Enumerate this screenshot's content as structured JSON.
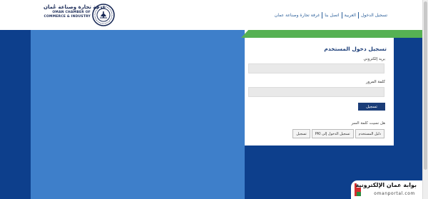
{
  "header": {
    "brand_ar": "غرفة تجارة وصناعة عُمان",
    "brand_en_line1": "OMAN CHAMBER OF",
    "brand_en_line2": "COMMERCE & INDUSTRY",
    "nav": [
      {
        "label": "تسجيل الدخول"
      },
      {
        "label": "العربية"
      },
      {
        "label": "اتصل بنا"
      },
      {
        "label": "غرفة تجارة وصناعة عمان"
      }
    ]
  },
  "login": {
    "title": "تسجيل دخول المستخدم",
    "email_label": "بريد إلكتروني",
    "email_value": "",
    "password_label": "كلمة المرور",
    "password_value": "",
    "login_button": "تسجيل",
    "forgot_text": "هل نسيت كلمة السر",
    "buttons": [
      {
        "label": "دليل المستخدم"
      },
      {
        "label": "PKI تسجيل الدخول إلى"
      },
      {
        "label": "تسجيل"
      }
    ]
  },
  "portal": {
    "name_ar": "بوابة عمان الإلكترونية",
    "domain": "omanportal.com"
  },
  "colors": {
    "navy": "#0d3f8c",
    "blue": "#3e7fca",
    "green": "#56b153",
    "title": "#1b3d78",
    "link": "#2b5f9a"
  }
}
